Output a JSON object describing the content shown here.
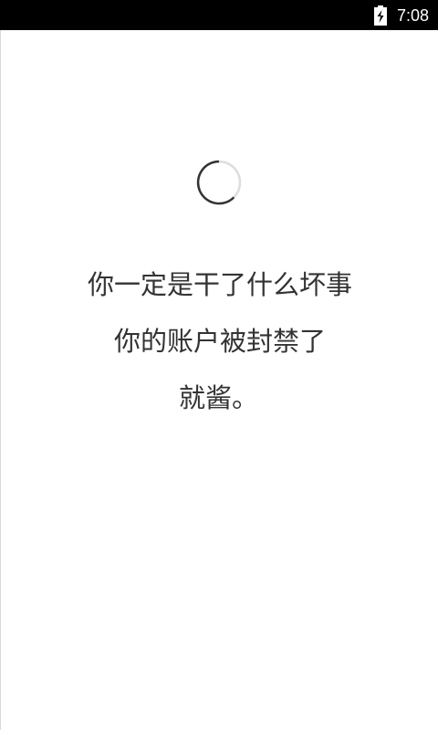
{
  "status_bar": {
    "time": "7:08",
    "battery_icon": "battery-charging-icon"
  },
  "loading": {
    "spinner_icon": "loading-spinner-icon"
  },
  "message": {
    "line1": "你一定是干了什么坏事",
    "line2": "你的账户被封禁了",
    "line3": "就酱。"
  },
  "colors": {
    "status_bar_bg": "#000000",
    "background": "#ffffff",
    "text": "#333333",
    "spinner_dark": "#333333",
    "spinner_light": "#dddddd"
  }
}
